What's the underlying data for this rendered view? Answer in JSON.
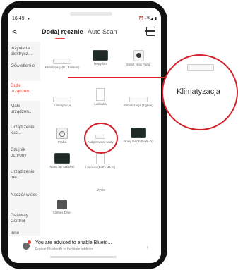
{
  "status": {
    "time": "16:49",
    "dot": "•",
    "right": "⏰ ᴸᵀᴱ◢ ▮"
  },
  "nav": {
    "back": "<",
    "tab_active": "Dodaj ręcznie",
    "tab_inactive": "Auto Scan",
    "scan_icon": "scan-icon"
  },
  "categories": [
    {
      "label": "Inżynieria elektrycz..."
    },
    {
      "label": "Oświetleni e"
    },
    {
      "label": "Duże urządzen..."
    },
    {
      "label": "Małe urządzen..."
    },
    {
      "label": "Urząd zenie kuc..."
    },
    {
      "label": "Czujnik ochrony"
    },
    {
      "label": "Urząd zenie me..."
    },
    {
      "label": "Nadzór wideo"
    },
    {
      "label": "Gateway Control"
    },
    {
      "label": "Inne"
    }
  ],
  "devices": [
    {
      "label": "Klimatyzacja(B LE+Wi-Fi)",
      "icon": "air-conditioner-icon"
    },
    {
      "label": "Nowy fan",
      "icon": "fan-icon"
    },
    {
      "label": "Smart Heat Pump",
      "icon": "heat-pump-icon"
    },
    {
      "label": "Klimatyzacja",
      "icon": "air-conditioner-icon"
    },
    {
      "label": "Lodówka",
      "icon": "fridge-icon"
    },
    {
      "label": "Klimatyzacja (Zigbee)",
      "icon": "air-conditioner-icon"
    },
    {
      "label": "Pralka",
      "icon": "washer-icon"
    },
    {
      "label": "Podgrzewacz wody",
      "icon": "water-heater-icon"
    },
    {
      "label": "Nowy fan(BLE+Wi-Fi)",
      "icon": "fan-icon"
    },
    {
      "label": "Nowy fan (Zigbee)",
      "icon": "fan-icon"
    },
    {
      "label": "Lodówka(BLE+ Wi-Fi)",
      "icon": "fridge-icon"
    },
    {
      "label": "Clothes Dryer",
      "icon": "dryer-icon"
    }
  ],
  "section_label": "życie",
  "bluetooth": {
    "title": "You are advised to enable Blueto...",
    "subtitle": "Enable Bluetooth to facilitate addition...",
    "arrow": "›"
  },
  "callout": {
    "label": "Klimatyzacja"
  },
  "colors": {
    "accent": "#e8433a",
    "highlight": "#d4202a"
  }
}
